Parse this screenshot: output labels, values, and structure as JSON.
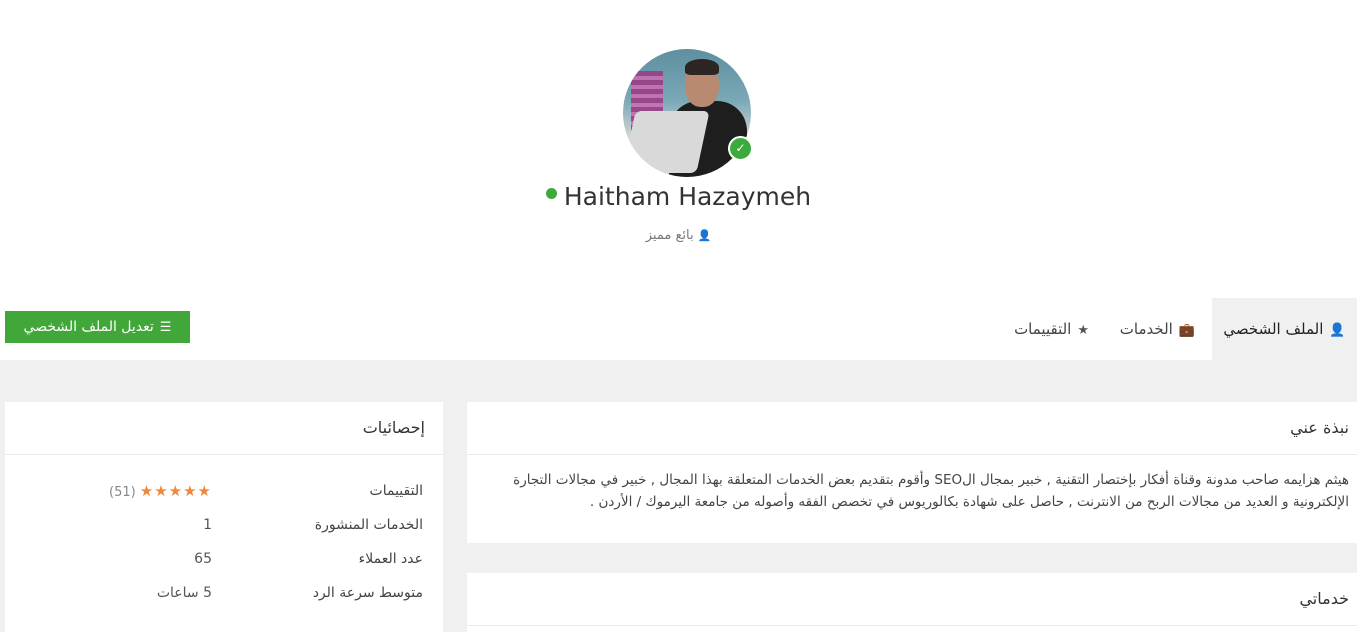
{
  "profile": {
    "name": "Haitham Hazaymeh",
    "role": "بائع مميز",
    "online": true,
    "verified": true,
    "status_color": "#3cab3c"
  },
  "tabs": [
    {
      "label": "الملف الشخصي",
      "icon": "user-icon",
      "active": true
    },
    {
      "label": "الخدمات",
      "icon": "briefcase-icon",
      "active": false
    },
    {
      "label": "التقييمات",
      "icon": "star-icon",
      "active": false
    }
  ],
  "edit_button": {
    "label": "تعديل الملف الشخصي",
    "icon": "sliders-icon",
    "color": "#42a739"
  },
  "about": {
    "title": "نبذة عني",
    "text": "هيثم هزايمه صاحب مدونة وقناة أفكار بإختصار التقنية , خبير بمجال الSEO وأقوم بتقديم بعض الخدمات المتعلقة بهذا المجال , خبير في مجالات التجارة الإلكترونية و العديد من مجالات الربح من الانترنت , حاصل على شهادة بكالوريوس في تخصص الفقه وأصوله من جامعة اليرموك / الأردن ."
  },
  "services": {
    "title": "خدماتي"
  },
  "stats": {
    "title": "إحصائيات",
    "rating": {
      "label": "التقييمات",
      "stars": 5,
      "count": "(51)",
      "star_color": "#f0873a"
    },
    "published_services": {
      "label": "الخدمات المنشورة",
      "value": "1"
    },
    "clients": {
      "label": "عدد العملاء",
      "value": "65"
    },
    "response_time": {
      "label": "متوسط سرعة الرد",
      "value": "5 ساعات"
    }
  }
}
